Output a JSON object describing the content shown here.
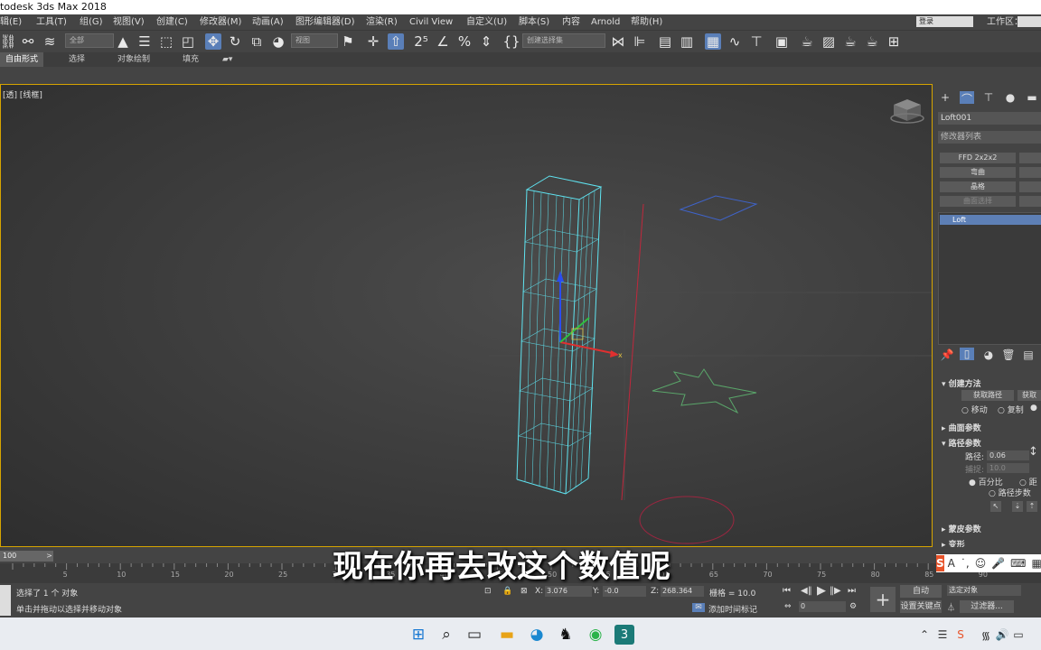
{
  "window": {
    "title": "todesk 3ds Max 2018"
  },
  "menu": {
    "items": [
      "辑(E)",
      "工具(T)",
      "组(G)",
      "视图(V)",
      "创建(C)",
      "修改器(M)",
      "动画(A)",
      "图形编辑器(D)",
      "渲染(R)",
      "Civil View",
      "自定义(U)",
      "脚本(S)",
      "内容",
      "Arnold",
      "帮助(H)"
    ],
    "login": "登录",
    "workspace": "工作区："
  },
  "toolbar": {
    "selection_filter": "全部",
    "ref_coord": "视图",
    "named_selection": "创建选择集"
  },
  "ribbon": {
    "tabs": [
      "自由形式",
      "选择",
      "对象绘制",
      "填充"
    ]
  },
  "viewport": {
    "label": "[透] [线框]"
  },
  "command_panel": {
    "object_name": "Loft001",
    "modifier_list": "修改器列表",
    "buttons": [
      "FFD 2x2x2",
      "弯曲",
      "晶格",
      "曲面选择"
    ],
    "stack_item": "Loft",
    "creation_method": {
      "title": "创建方法",
      "get_path": "获取路径",
      "get_shape": "获取",
      "move": "移动",
      "copy": "复制"
    },
    "surface_params": "曲面参数",
    "path_params": {
      "title": "路径参数",
      "path_label": "路径:",
      "path_value": "0.06",
      "snap_label": "捕捉:",
      "snap_value": "10.0",
      "percentage": "百分比",
      "distance": "距",
      "path_steps": "路径步数"
    },
    "skin_params": "蒙皮参数",
    "deformation": "变形"
  },
  "timeline": {
    "frame_display": "100",
    "ticks": [
      "5",
      "10",
      "15",
      "20",
      "25",
      "30",
      "35",
      "40",
      "45",
      "50",
      "55",
      "60",
      "65",
      "70",
      "75",
      "80",
      "85",
      "90",
      "95"
    ]
  },
  "status": {
    "selection_text": "选择了 1 个 对象",
    "prompt_text": "单击并拖动以选择并移动对象",
    "x_value": "3.076",
    "y_value": "-0.0",
    "z_value": "268.364",
    "grid": "栅格 = 10.0",
    "add_time_tag": "添加时间标记",
    "auto_key": "自动",
    "set_key": "设置关键点",
    "selected_object": "选定对象",
    "key_filters": "过滤器...",
    "current_frame": "0"
  },
  "subtitle": "现在你再去改这个数值呢",
  "ime": {
    "label": "S A"
  },
  "colors": {
    "accent": "#5a7fb8",
    "viewport_border": "#d6a400",
    "wireframe": "#5fe3f0"
  },
  "icons": [
    "link-icon",
    "select-icon",
    "move-icon",
    "rotate-icon",
    "scale-icon",
    "snap-icon",
    "render-icon"
  ]
}
